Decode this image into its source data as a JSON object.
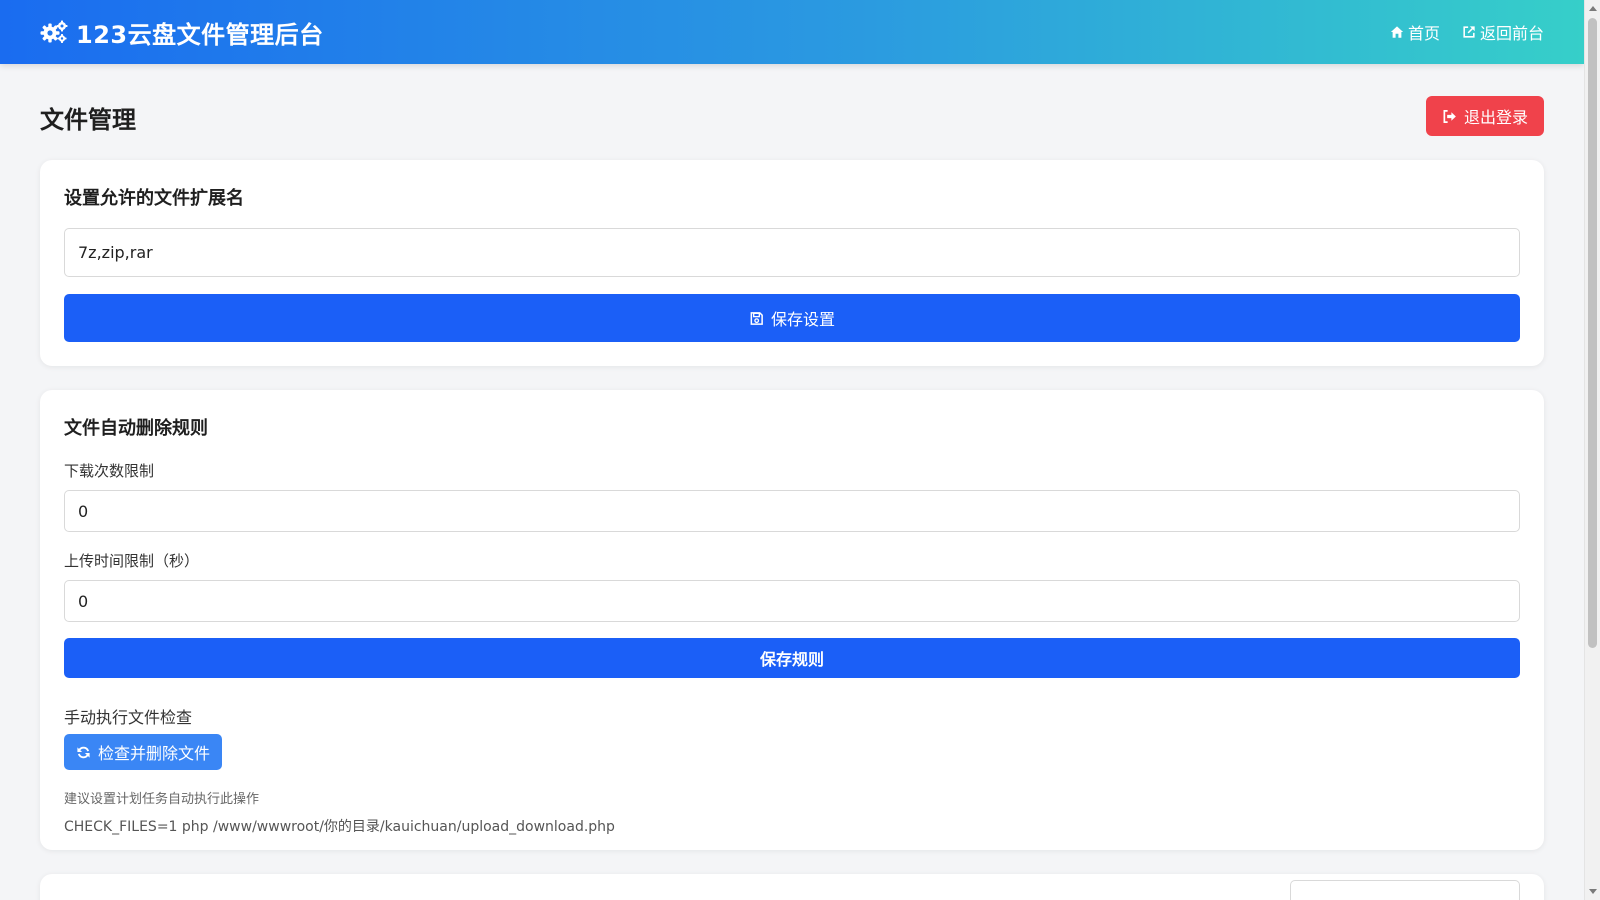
{
  "header": {
    "title": "123云盘文件管理后台",
    "nav": [
      {
        "label": "首页",
        "icon": "home-icon"
      },
      {
        "label": "返回前台",
        "icon": "external-link-icon"
      }
    ]
  },
  "page": {
    "title": "文件管理",
    "logout_label": "退出登录"
  },
  "extensions_card": {
    "title": "设置允许的文件扩展名",
    "input_value": "7z,zip,rar",
    "save_label": "保存设置"
  },
  "delete_rules_card": {
    "title": "文件自动删除规则",
    "download_limit_label": "下载次数限制",
    "download_limit_value": "0",
    "upload_time_label": "上传时间限制（秒）",
    "upload_time_value": "0",
    "save_label": "保存规则",
    "manual_check_label": "手动执行文件检查",
    "check_button_label": "检查并删除文件",
    "hint": "建议设置计划任务自动执行此操作",
    "command": "CHECK_FILES=1 php /www/wwwroot/你的目录/kauichuan/upload_download.php"
  },
  "colors": {
    "header_gradient_start": "#1a6cf0",
    "header_gradient_end": "#36cfc9",
    "primary": "#1b5ff7",
    "danger": "#f0424b",
    "check_button": "#3a86f5"
  }
}
